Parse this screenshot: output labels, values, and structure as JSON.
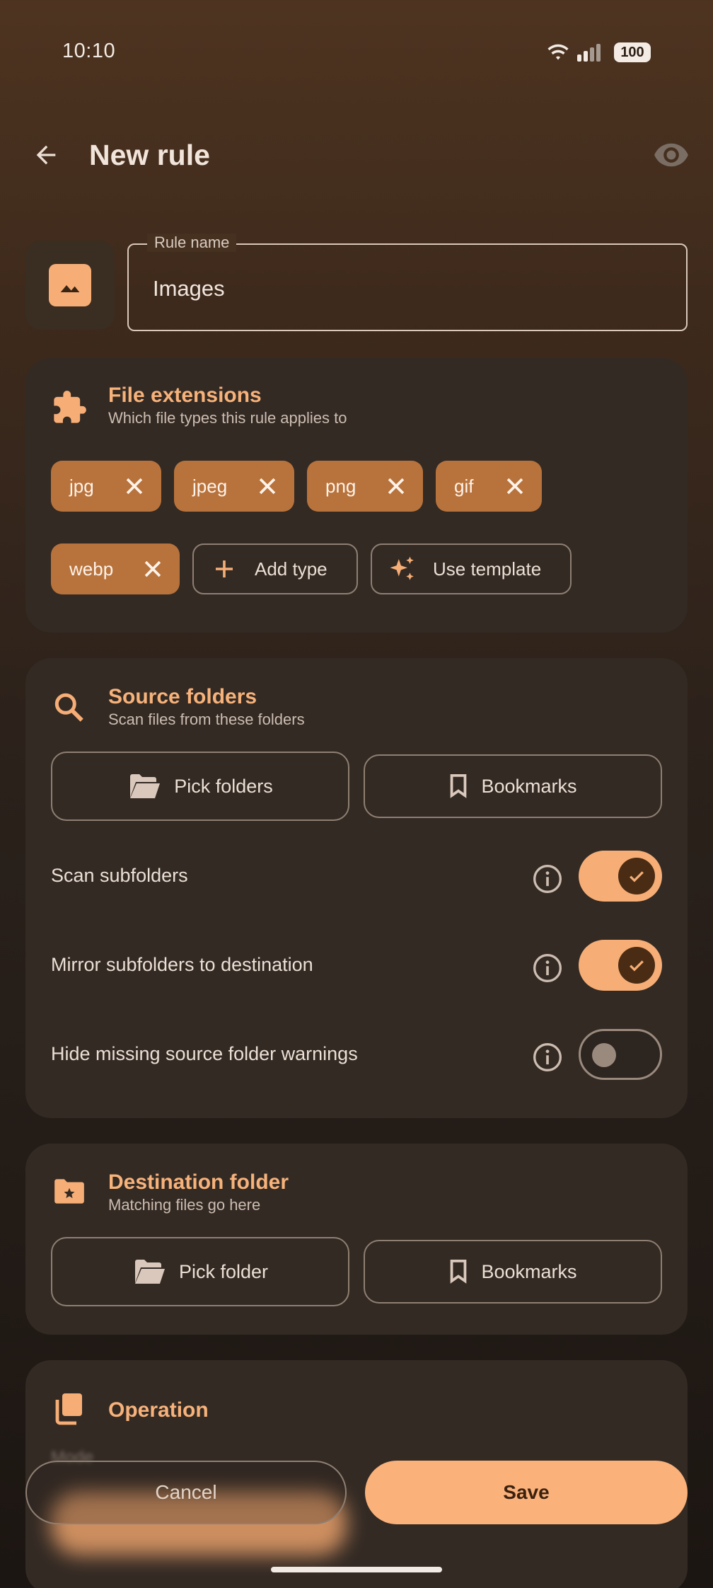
{
  "status_bar": {
    "time": "10:10",
    "battery": "100"
  },
  "app_bar": {
    "title": "New rule"
  },
  "rule_name": {
    "label": "Rule name",
    "value": "Images"
  },
  "file_extensions": {
    "title": "File extensions",
    "subtitle": "Which file types this rule applies to",
    "chips": [
      "jpg",
      "jpeg",
      "png",
      "gif",
      "webp"
    ],
    "add_type_label": "Add type",
    "use_template_label": "Use template"
  },
  "source_folders": {
    "title": "Source folders",
    "subtitle": "Scan files from these folders",
    "pick_label": "Pick folders",
    "bookmarks_label": "Bookmarks",
    "toggles": [
      {
        "label": "Scan subfolders",
        "on": true
      },
      {
        "label": "Mirror subfolders to destination",
        "on": true
      },
      {
        "label": "Hide missing source folder warnings",
        "on": false
      }
    ]
  },
  "destination_folder": {
    "title": "Destination folder",
    "subtitle": "Matching files go here",
    "pick_label": "Pick folder",
    "bookmarks_label": "Bookmarks"
  },
  "operation": {
    "title": "Operation",
    "mode_label": "Mode"
  },
  "actions": {
    "cancel_label": "Cancel",
    "save_label": "Save"
  },
  "colors": {
    "accent": "#f6ae76",
    "chip": "#b8733c",
    "card": "#332a24"
  }
}
